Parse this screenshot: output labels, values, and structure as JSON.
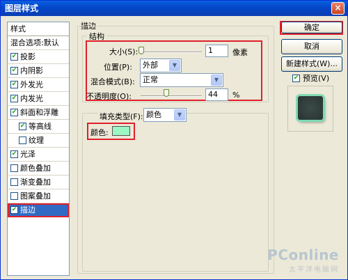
{
  "window": {
    "title": "图层样式",
    "close_label": "×"
  },
  "styles_list": {
    "header": "样式",
    "items": [
      {
        "label": "混合选项:默认",
        "checkbox": false,
        "checked": false,
        "indent": false,
        "selected": false
      },
      {
        "label": "投影",
        "checkbox": true,
        "checked": true,
        "indent": false,
        "selected": false
      },
      {
        "label": "内阴影",
        "checkbox": true,
        "checked": true,
        "indent": false,
        "selected": false
      },
      {
        "label": "外发光",
        "checkbox": true,
        "checked": true,
        "indent": false,
        "selected": false
      },
      {
        "label": "内发光",
        "checkbox": true,
        "checked": true,
        "indent": false,
        "selected": false
      },
      {
        "label": "斜面和浮雕",
        "checkbox": true,
        "checked": true,
        "indent": false,
        "selected": false
      },
      {
        "label": "等高线",
        "checkbox": true,
        "checked": true,
        "indent": true,
        "selected": false
      },
      {
        "label": "纹理",
        "checkbox": true,
        "checked": false,
        "indent": true,
        "selected": false
      },
      {
        "label": "光泽",
        "checkbox": true,
        "checked": true,
        "indent": false,
        "selected": false
      },
      {
        "label": "颜色叠加",
        "checkbox": true,
        "checked": false,
        "indent": false,
        "selected": false
      },
      {
        "label": "渐变叠加",
        "checkbox": true,
        "checked": false,
        "indent": false,
        "selected": false
      },
      {
        "label": "图案叠加",
        "checkbox": true,
        "checked": false,
        "indent": false,
        "selected": false
      },
      {
        "label": "描边",
        "checkbox": true,
        "checked": true,
        "indent": false,
        "selected": true
      }
    ]
  },
  "stroke": {
    "group_title": "描边",
    "structure_title": "结构",
    "size_label": "大小(S):",
    "size_value": "1",
    "size_unit": "像素",
    "position_label": "位置(P):",
    "position_value": "外部",
    "blend_label": "混合模式(B):",
    "blend_value": "正常",
    "opacity_label": "不透明度(O):",
    "opacity_value": "44",
    "opacity_unit": "%",
    "fill_type_label": "填充类型(F):",
    "fill_type_value": "颜色",
    "color_label": "颜色:",
    "color_hex": "#9cf7c3"
  },
  "buttons": {
    "ok": "确定",
    "cancel": "取消",
    "new_style": "新建样式(W)...",
    "preview_label": "预览(V)",
    "preview_checked": true
  },
  "watermark": {
    "main": "PConline",
    "sub": "太平洋电脑网"
  },
  "colors": {
    "highlight": "#e0202a",
    "selection": "#316ac5",
    "title_bar": "#0a5fe0"
  }
}
